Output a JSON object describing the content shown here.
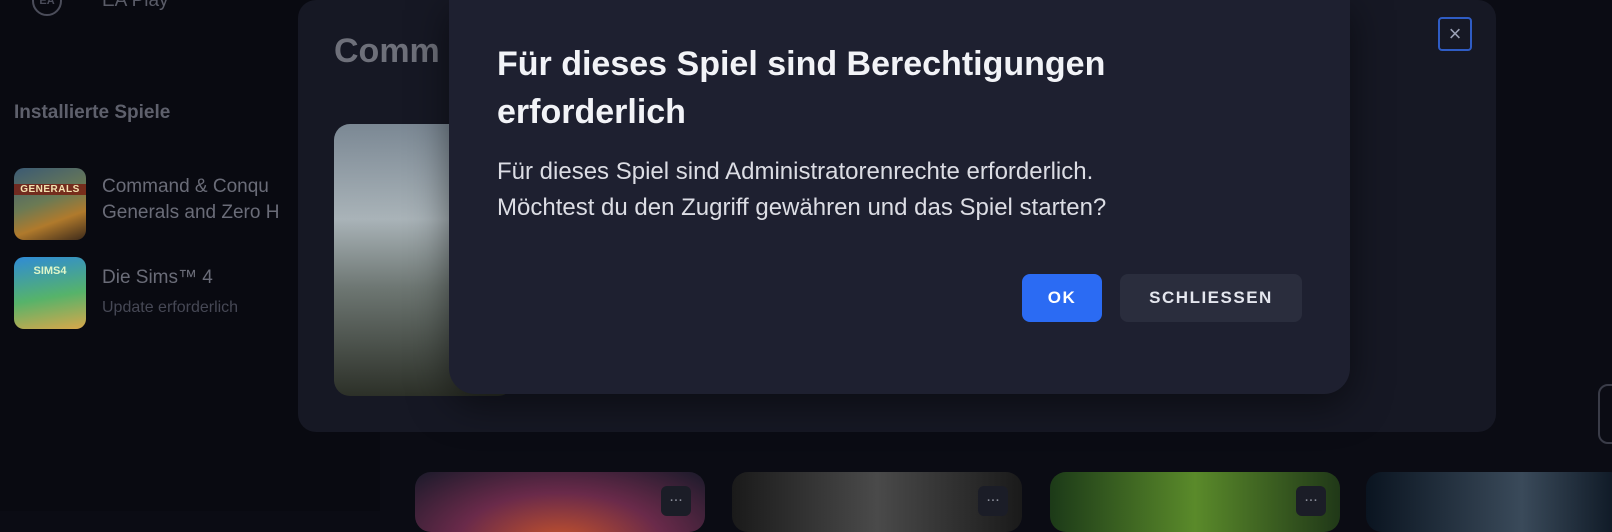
{
  "sidebar": {
    "ea_play_logo": "EA",
    "ea_play_label": "EA Play",
    "installed_title": "Installierte Spiele",
    "games": [
      {
        "thumb_tag": "GENERALS",
        "title": "Command & Conqu\nGenerals and Zero H",
        "subtitle": ""
      },
      {
        "thumb_tag": "SIMS4",
        "title": "Die Sims™ 4",
        "subtitle": "Update erforderlich"
      }
    ]
  },
  "background_panel": {
    "title": "Comm",
    "close_icon": "×"
  },
  "cards": [
    {
      "more": "..."
    },
    {
      "more": "..."
    },
    {
      "more": "..."
    }
  ],
  "dialog": {
    "heading": "Für dieses Spiel sind Berechtigungen erforderlich",
    "body": "Für dieses Spiel sind Administratorenrechte erforderlich.\nMöchtest du den Zugriff gewähren und das Spiel starten?",
    "ok_label": "OK",
    "close_label": "SCHLIESSEN"
  },
  "colors": {
    "accent": "#2b6bf3",
    "dialog_bg": "#1e2030",
    "page_bg": "#0b0c14"
  }
}
